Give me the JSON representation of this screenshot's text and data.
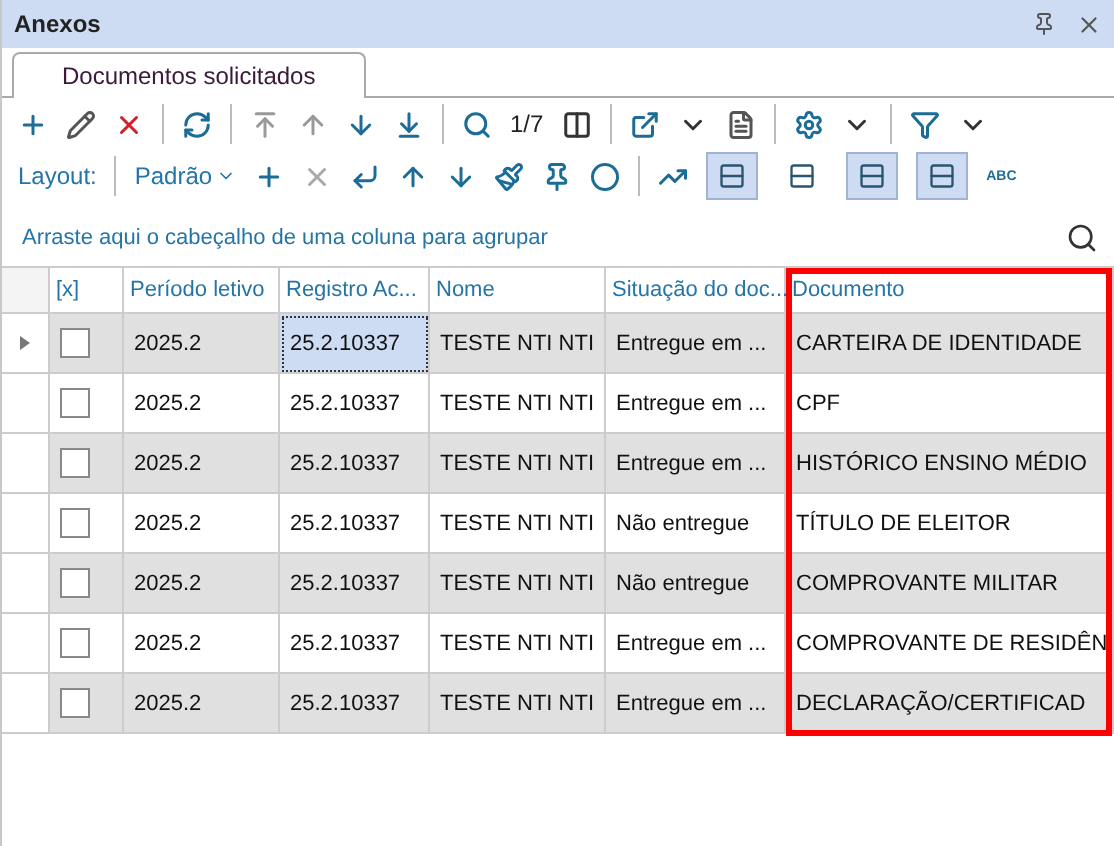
{
  "window": {
    "title": "Anexos"
  },
  "tabs": [
    {
      "label": "Documentos solicitados",
      "selected": true
    }
  ],
  "toolbar": {
    "page": "1/7"
  },
  "layout_bar": {
    "label": "Layout:",
    "value": "Padrão",
    "toggles": [
      {
        "pressed": true
      },
      {
        "pressed": false
      },
      {
        "pressed": true
      },
      {
        "pressed": true
      }
    ],
    "abc": "ABC"
  },
  "group_hint": "Arraste aqui o cabeçalho de uma coluna para agrupar",
  "table": {
    "check_column": "[x]",
    "columns": [
      {
        "label": "Período letivo",
        "highlighted": false
      },
      {
        "label": "Registro Ac...",
        "highlighted": false
      },
      {
        "label": "Nome",
        "highlighted": false
      },
      {
        "label": "Situação do doc...",
        "highlighted": false
      },
      {
        "label": "Documento",
        "highlighted": true
      }
    ],
    "rows": [
      {
        "selected": true,
        "checked": false,
        "cells": [
          "2025.2",
          "25.2.10337",
          "TESTE NTI NTI",
          "Entregue em ...",
          "CARTEIRA DE IDENTIDADE"
        ]
      },
      {
        "selected": false,
        "checked": false,
        "cells": [
          "2025.2",
          "25.2.10337",
          "TESTE NTI NTI",
          "Entregue em ...",
          "CPF"
        ]
      },
      {
        "selected": false,
        "checked": false,
        "cells": [
          "2025.2",
          "25.2.10337",
          "TESTE NTI NTI",
          "Entregue em ...",
          "HISTÓRICO ENSINO MÉDIO"
        ]
      },
      {
        "selected": false,
        "checked": false,
        "cells": [
          "2025.2",
          "25.2.10337",
          "TESTE NTI NTI",
          "Não entregue",
          "TÍTULO DE ELEITOR"
        ]
      },
      {
        "selected": false,
        "checked": false,
        "cells": [
          "2025.2",
          "25.2.10337",
          "TESTE NTI NTI",
          "Não entregue",
          "COMPROVANTE MILITAR"
        ]
      },
      {
        "selected": false,
        "checked": false,
        "cells": [
          "2025.2",
          "25.2.10337",
          "TESTE NTI NTI",
          "Entregue em ...",
          "COMPROVANTE DE RESIDÊN"
        ]
      },
      {
        "selected": false,
        "checked": false,
        "cells": [
          "2025.2",
          "25.2.10337",
          "TESTE NTI NTI",
          "Entregue em ...",
          "DECLARAÇÃO/CERTIFICAD"
        ]
      }
    ]
  }
}
